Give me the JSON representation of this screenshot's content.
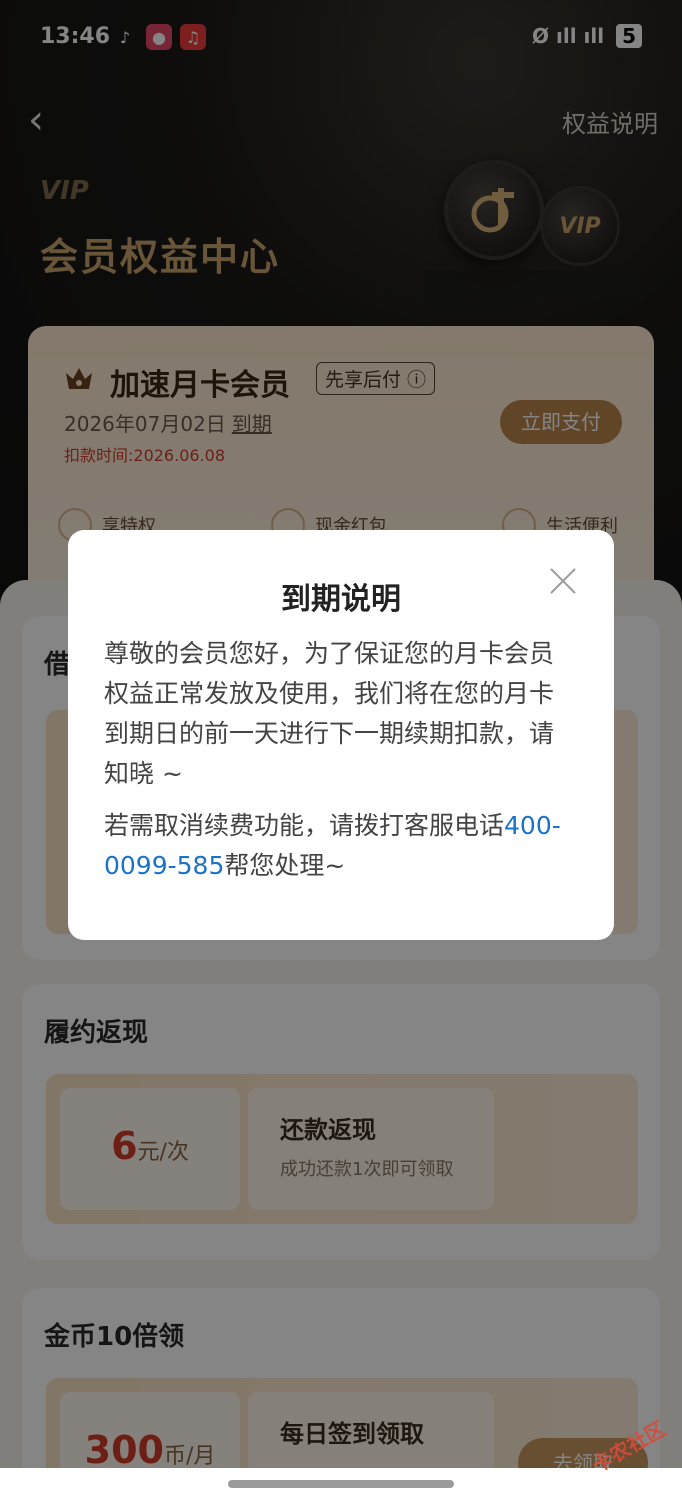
{
  "status_bar": {
    "time": "13:46",
    "battery": "5",
    "signal": "Ø ıll ıll"
  },
  "header": {
    "back_symbol": "‹",
    "rights_link": "权益说明",
    "vip_label": "VIP",
    "title": "会员权益中心",
    "coin_small_label": "VIP"
  },
  "member_card": {
    "title": "加速月卡会员",
    "tag": "先享后付 ⓘ",
    "expire_date": "2026年07月02日",
    "expire_link": "到期",
    "deduct_time": "扣款时间:2026.06.08",
    "pay_button": "立即支付",
    "benefits": [
      "享特权",
      "现金红包",
      "生活便利"
    ]
  },
  "sections": {
    "partial_title": "借",
    "cashback": {
      "title": "履约返现",
      "amount": "6",
      "unit": "元/次",
      "name": "还款返现",
      "desc": "成功还款1次即可领取"
    },
    "coins": {
      "title": "金币10倍领",
      "amount": "300",
      "unit": "币/月",
      "name": "每日签到领取",
      "button": "去领取"
    }
  },
  "modal": {
    "title": "到期说明",
    "body": "尊敬的会员您好，为了保证您的月卡会员权益正常发放及使用，我们将在您的月卡到期日的前一天进行下一期续期扣款，请知晓 ~",
    "note_prefix": "若需取消续费功能，请拨打客服电话",
    "phone": "400-0099-585",
    "note_suffix": "帮您处理~"
  },
  "watermark": "卡农社区"
}
